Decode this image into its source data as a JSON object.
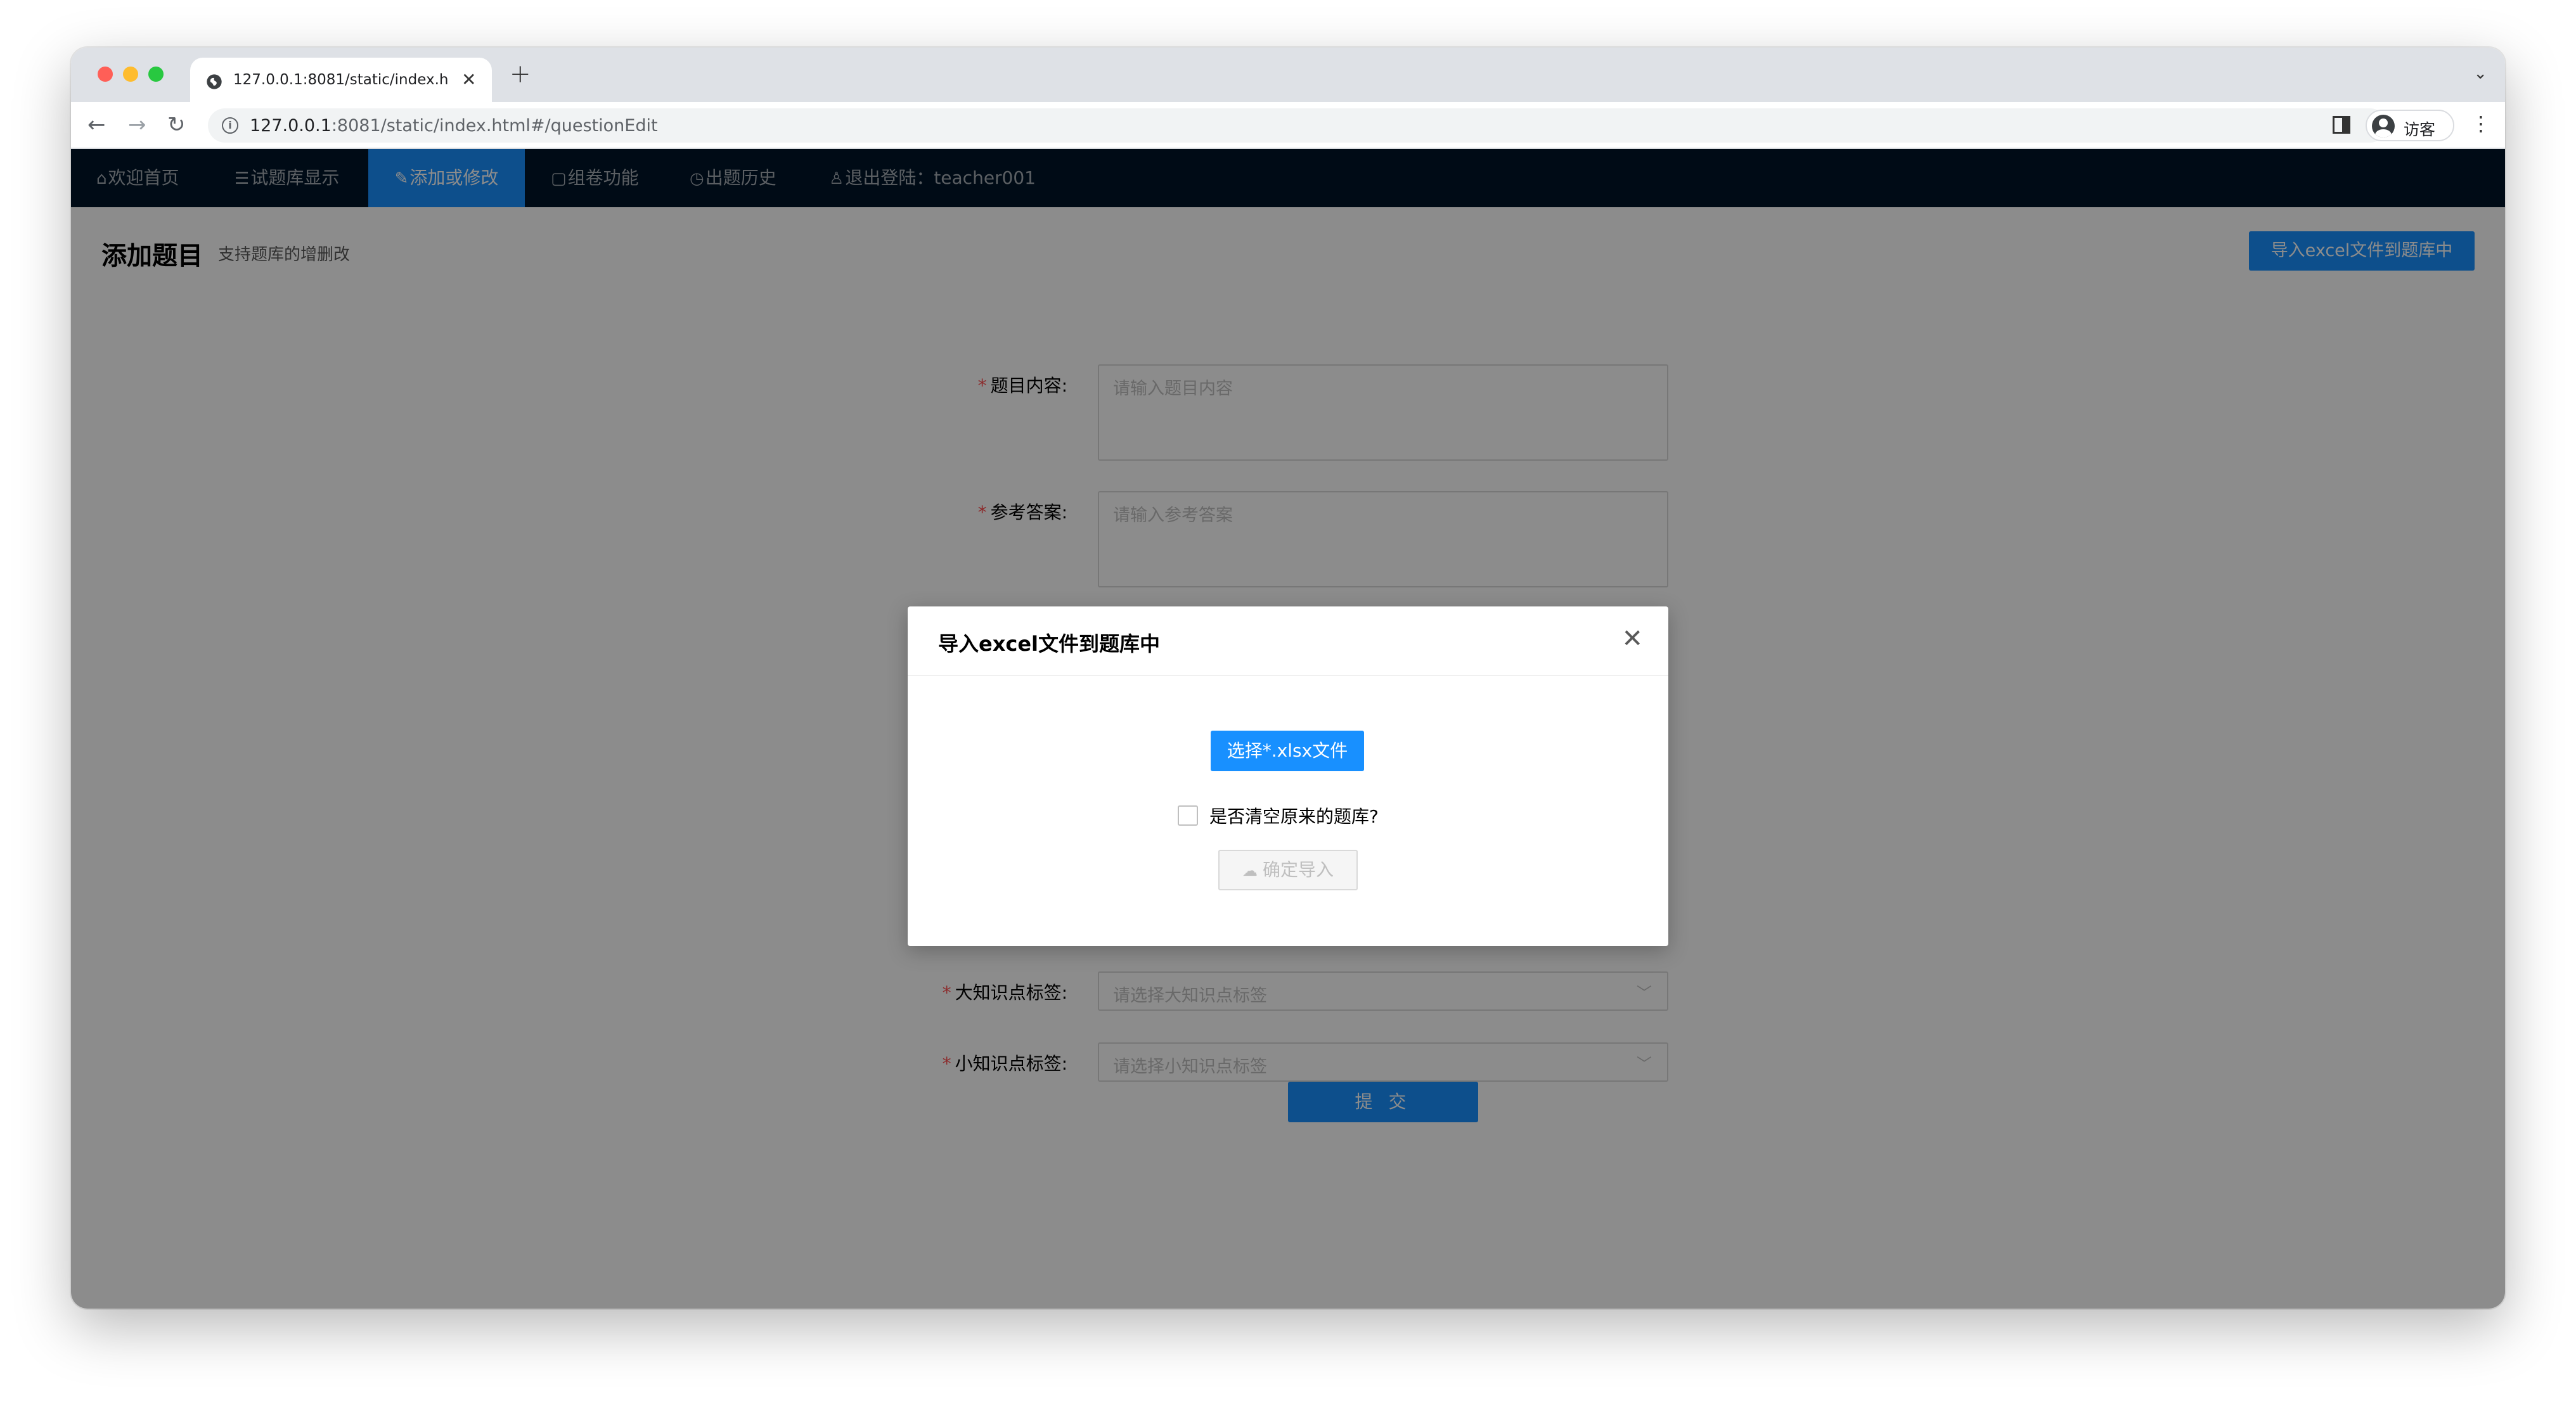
{
  "browser": {
    "tab_title": "127.0.0.1:8081/static/index.htm",
    "tab_close": "✕",
    "new_tab": "+",
    "tab_menu": "⌄",
    "url_host": "127.0.0.1",
    "url_path": ":8081/static/index.html#/questionEdit",
    "profile_label": "访客",
    "icons": [
      "globe-icon",
      "back-icon",
      "forward-icon",
      "reload-icon",
      "info-icon",
      "side-panel-icon",
      "avatar-icon",
      "kebab-menu-icon"
    ]
  },
  "nav": {
    "items": [
      {
        "icon": "⌂",
        "label": "欢迎首页"
      },
      {
        "icon": "☰",
        "label": "试题库显示"
      },
      {
        "icon": "✎",
        "label": "添加或修改"
      },
      {
        "icon": "▢",
        "label": "组卷功能"
      },
      {
        "icon": "◷",
        "label": "出题历史"
      },
      {
        "icon": "♙",
        "label": "退出登陆：teacher001"
      }
    ],
    "active_index": 2,
    "active_color": "#1890ff",
    "background": "#001529"
  },
  "header": {
    "title": "添加题目",
    "subtitle": "支持题库的增删改",
    "import_button": "导入excel文件到题库中"
  },
  "form": {
    "required_mark": "*",
    "question_label": "题目内容:",
    "question_placeholder": "请输入题目内容",
    "answer_label": "参考答案:",
    "answer_placeholder": "请输入参考答案",
    "major_tag_label": "大知识点标签:",
    "major_tag_placeholder": "请选择大知识点标签",
    "minor_tag_label": "小知识点标签:",
    "minor_tag_placeholder": "请选择小知识点标签",
    "submit_label": "提 交"
  },
  "modal": {
    "title": "导入excel文件到题库中",
    "close": "✕",
    "choose_file_button": "选择*.xlsx文件",
    "clear_checkbox_label": "是否清空原来的题库?",
    "clear_checked": false,
    "confirm_button": "确定导入",
    "confirm_icon": "☁"
  },
  "colors": {
    "primary": "#1890ff",
    "required": "#ff4d4f"
  }
}
